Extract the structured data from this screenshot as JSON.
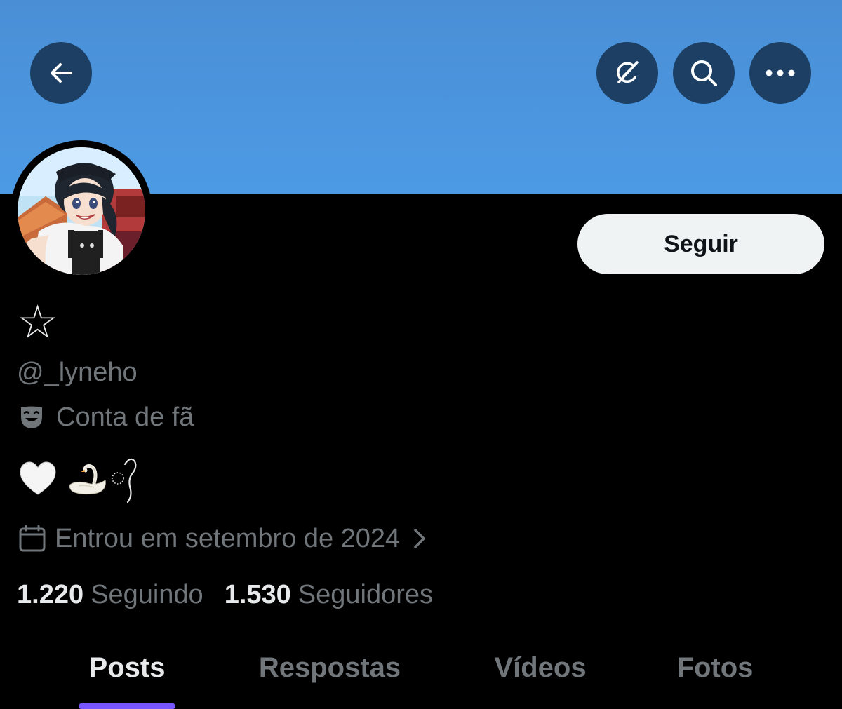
{
  "header": {
    "back_icon": "arrow-left-icon",
    "grok_icon": "grok-icon",
    "search_icon": "search-icon",
    "more_icon": "more-horizontal-icon",
    "banner_color": "#4c9ae4"
  },
  "profile": {
    "display_name": "☆",
    "handle": "@_lyneho",
    "label": "Conta de fã",
    "label_icon": "theater-mask-icon",
    "bio_icons": [
      "white-heart-icon",
      "swan-icon",
      "earring-icon"
    ],
    "joined": "Entrou em setembro de 2024",
    "joined_icon": "calendar-icon"
  },
  "actions": {
    "follow_label": "Seguir"
  },
  "stats": {
    "following_count": "1.220",
    "following_label": "Seguindo",
    "followers_count": "1.530",
    "followers_label": "Seguidores"
  },
  "tabs": [
    {
      "label": "Posts",
      "active": true
    },
    {
      "label": "Respostas",
      "active": false
    },
    {
      "label": "Vídeos",
      "active": false
    },
    {
      "label": "Fotos",
      "active": false
    }
  ],
  "colors": {
    "accent": "#7856ff",
    "muted_text": "#71767b",
    "primary_text": "#e7e9ea"
  }
}
